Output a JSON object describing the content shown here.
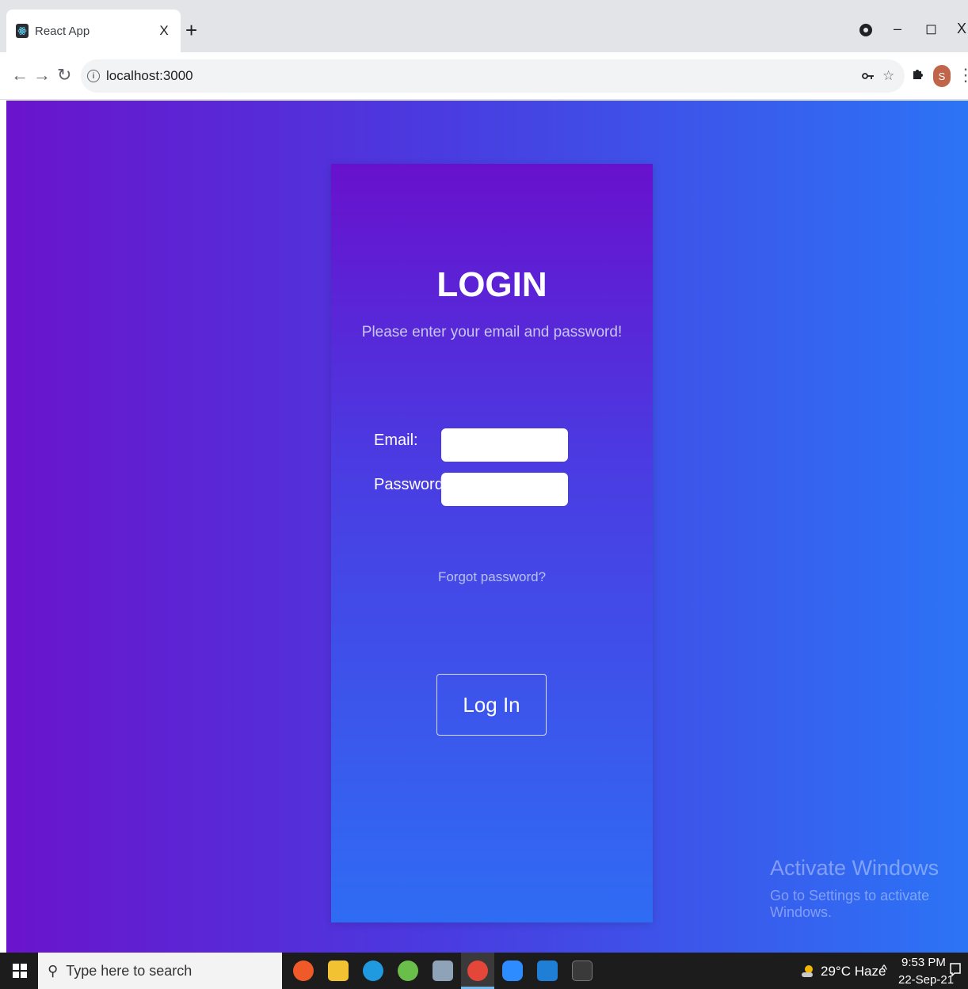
{
  "browser": {
    "tab_title": "React App",
    "tab_close": "X",
    "new_tab": "+",
    "minimize": "–",
    "maximize": "◻",
    "close": "X",
    "url": "localhost:3000",
    "profile_initial": "S"
  },
  "login": {
    "title": "LOGIN",
    "subtitle": "Please enter your email and password!",
    "email_label": "Email:",
    "password_label": "Password:",
    "forgot_password": "Forgot password?",
    "submit_label": "Log In"
  },
  "watermark": {
    "title": "Activate Windows",
    "subtitle": "Go to Settings to activate Windows."
  },
  "taskbar": {
    "search_placeholder": "Type here to search",
    "weather": "29°C  Haze",
    "time": "9:53 PM",
    "date": "22-Sep-21"
  },
  "colors": {
    "gradient_left": "#6a14cc",
    "gradient_right": "#2c74f6",
    "card_top": "#6811cd",
    "card_bottom": "#2f6cf4"
  }
}
